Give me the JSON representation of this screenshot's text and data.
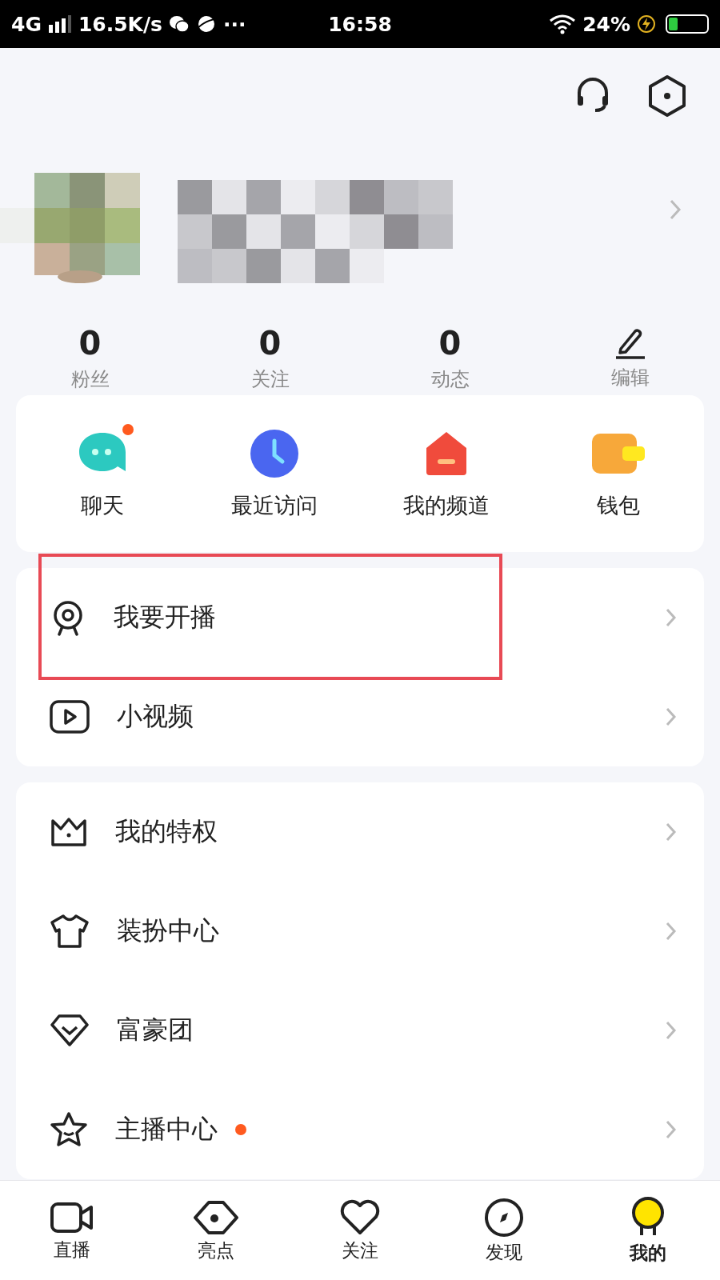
{
  "status_bar": {
    "network": "4G",
    "speed": "16.5K/s",
    "more": "···",
    "time": "16:58",
    "battery": "24%",
    "charging": true
  },
  "profile": {
    "avatar": {
      "kind": "picture"
    }
  },
  "stats": [
    {
      "value": "0",
      "label": "粉丝"
    },
    {
      "value": "0",
      "label": "关注"
    },
    {
      "value": "0",
      "label": "动态"
    }
  ],
  "edit": {
    "label": "编辑"
  },
  "shortcuts": [
    {
      "label": "聊天",
      "badge": true
    },
    {
      "label": "最近访问",
      "badge": false
    },
    {
      "label": "我的频道",
      "badge": false
    },
    {
      "label": "钱包",
      "badge": false
    }
  ],
  "menu_groups": [
    [
      {
        "label": "我要开播",
        "dot": false,
        "highlighted": true
      },
      {
        "label": "小视频",
        "dot": false,
        "highlighted": false
      }
    ],
    [
      {
        "label": "我的特权",
        "dot": false,
        "highlighted": false
      },
      {
        "label": "装扮中心",
        "dot": false,
        "highlighted": false
      },
      {
        "label": "富豪团",
        "dot": false,
        "highlighted": false
      },
      {
        "label": "主播中心",
        "dot": true,
        "highlighted": false
      }
    ]
  ],
  "bottom_nav": [
    {
      "label": "直播",
      "selected": false
    },
    {
      "label": "亮点",
      "selected": false
    },
    {
      "label": "关注",
      "selected": false
    },
    {
      "label": "发现",
      "selected": false
    },
    {
      "label": "我的",
      "selected": true
    }
  ]
}
